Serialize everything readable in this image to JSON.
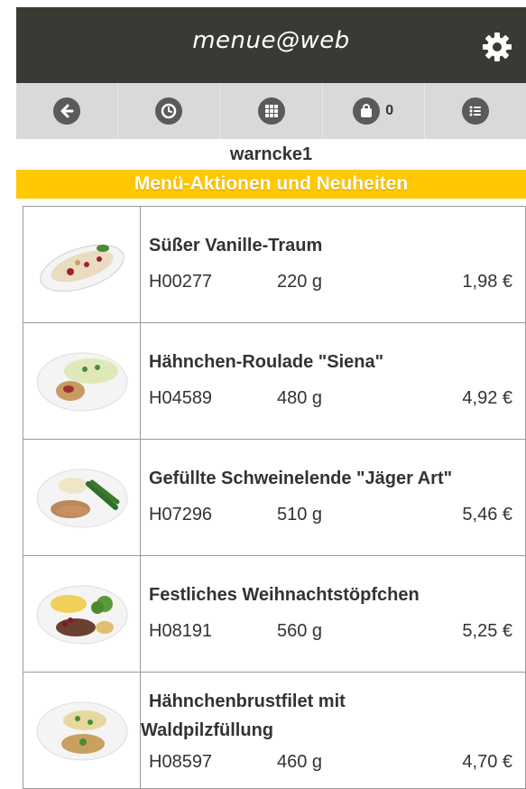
{
  "app": {
    "title": "menue@web"
  },
  "nav": {
    "items": [
      {
        "icon": "back-arrow-icon"
      },
      {
        "icon": "clock-icon"
      },
      {
        "icon": "grid-icon"
      },
      {
        "icon": "shopping-bag-icon",
        "count": "0"
      },
      {
        "icon": "list-icon"
      }
    ]
  },
  "user": {
    "name": "warncke1"
  },
  "promo": {
    "label": "Menü-Aktionen und Neuheiten"
  },
  "products": [
    {
      "name": "Süßer Vanille-Traum",
      "code": "H00277",
      "weight": "220 g",
      "price": "1,98 €"
    },
    {
      "name": "Hähnchen-Roulade \"Siena\"",
      "code": "H04589",
      "weight": "480 g",
      "price": "4,92 €"
    },
    {
      "name": "Gefüllte Schweinelende \"Jäger Art\"",
      "code": "H07296",
      "weight": "510 g",
      "price": "5,46 €"
    },
    {
      "name": "Festliches Weihnachtstöpfchen",
      "code": "H08191",
      "weight": "560 g",
      "price": "5,25 €"
    },
    {
      "name_line1": "Hähnchenbrustfilet mit",
      "name_line2": "Waldpilzfüllung",
      "code": "H08597",
      "weight": "460 g",
      "price": "4,70 €"
    }
  ],
  "colors": {
    "topbar": "#3a3a35",
    "navbar": "#d9d9d9",
    "promo": "#ffc800"
  }
}
